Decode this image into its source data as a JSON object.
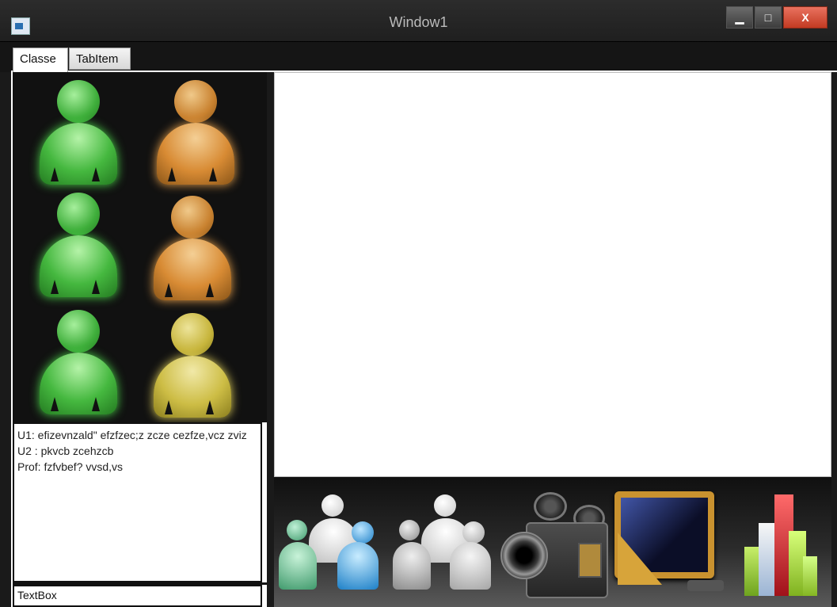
{
  "window": {
    "title": "Window1",
    "buttons": {
      "minimize": "▁",
      "maximize": "□",
      "close": "X"
    }
  },
  "tabs": [
    {
      "label": "Classe",
      "active": true
    },
    {
      "label": "TabItem",
      "active": false
    }
  ],
  "users": [
    {
      "color": "green",
      "status_color": "#3fae3b"
    },
    {
      "color": "orange",
      "status_color": "#d88b34"
    },
    {
      "color": "green",
      "status_color": "#3fae3b"
    },
    {
      "color": "orange",
      "status_color": "#d88b34"
    },
    {
      "color": "green",
      "status_color": "#3fae3b"
    },
    {
      "color": "yellow",
      "status_color": "#cdbd45"
    }
  ],
  "chat": {
    "lines": [
      " U1: efizevnzald\" efzfzec;z zcze cezfze,vcz zviz",
      " U2 : pkvcb zcehzcb",
      " Prof: fzfvbef? vvsd,vs"
    ]
  },
  "textbox": {
    "value": "TextBox"
  },
  "toolbar": {
    "icons": [
      "group-color-icon",
      "group-gray-icon",
      "video-camera-icon",
      "blackboard-icon",
      "bar-chart-icon"
    ]
  }
}
